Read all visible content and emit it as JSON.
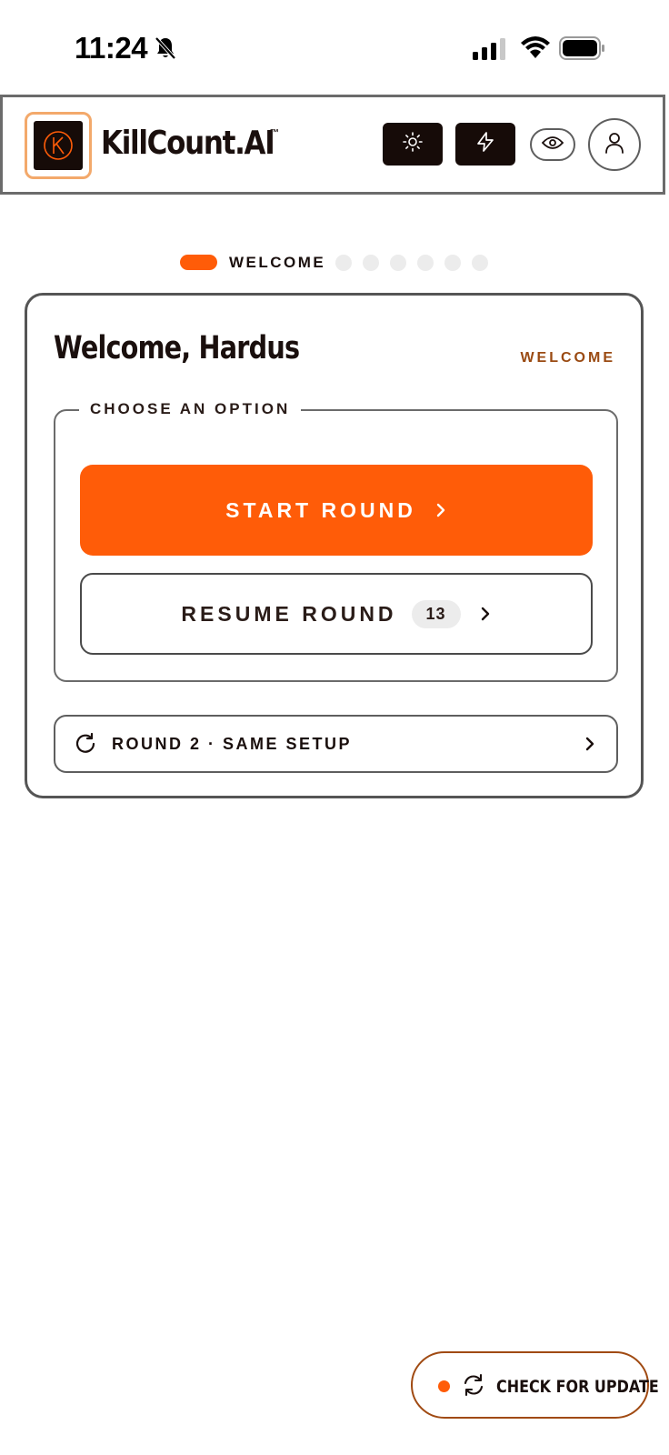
{
  "status_bar": {
    "time": "11:24",
    "icons": [
      "bell-slash-icon",
      "cellular-signal-icon",
      "wifi-icon",
      "battery-icon"
    ]
  },
  "header": {
    "brand": "KillCount.AI",
    "trademark": "™",
    "logo_letter": "K",
    "buttons": [
      "sun-icon",
      "bolt-icon",
      "eye-icon",
      "user-icon"
    ]
  },
  "stepper": {
    "active_label": "WELCOME",
    "total_steps": 7,
    "active_index": 0
  },
  "card": {
    "title": "Welcome, Hardus",
    "tag": "WELCOME",
    "options_legend": "CHOOSE AN OPTION",
    "start_label": "START ROUND",
    "resume_label": "RESUME ROUND",
    "resume_count": "13",
    "round2_label": "ROUND 2 · SAME SETUP"
  },
  "update": {
    "label": "CHECK FOR UPDATE"
  },
  "colors": {
    "accent": "#ff5c08",
    "dark": "#160b08",
    "brown_text": "#9a4a12",
    "logo_border": "#f3a96b"
  }
}
